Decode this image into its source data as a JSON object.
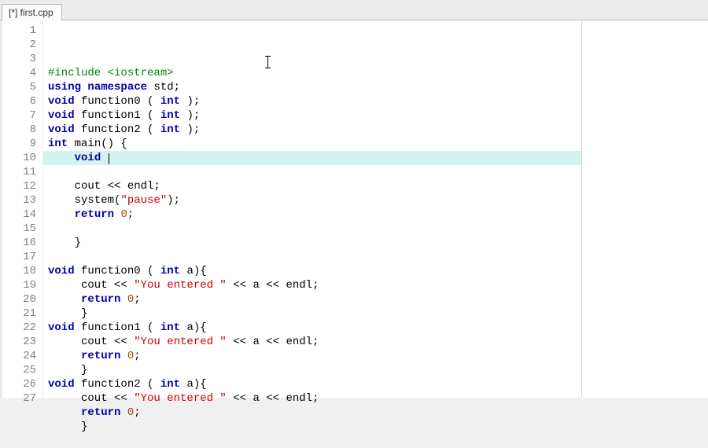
{
  "tab": {
    "title": "[*] first.cpp"
  },
  "lines": [
    {
      "n": 1,
      "segs": [
        [
          "pp",
          "#include "
        ],
        [
          "pp",
          "<iostream>"
        ]
      ]
    },
    {
      "n": 2,
      "segs": [
        [
          "kw",
          "using"
        ],
        [
          "",
          " "
        ],
        [
          "kw",
          "namespace"
        ],
        [
          "",
          " std;"
        ]
      ]
    },
    {
      "n": 3,
      "segs": [
        [
          "kw",
          "void"
        ],
        [
          "",
          " function0 ( "
        ],
        [
          "kw",
          "int"
        ],
        [
          "",
          " );"
        ]
      ]
    },
    {
      "n": 4,
      "segs": [
        [
          "kw",
          "void"
        ],
        [
          "",
          " function1 ( "
        ],
        [
          "kw",
          "int"
        ],
        [
          "",
          " );"
        ]
      ]
    },
    {
      "n": 5,
      "segs": [
        [
          "kw",
          "void"
        ],
        [
          "",
          " function2 ( "
        ],
        [
          "kw",
          "int"
        ],
        [
          "",
          " );"
        ]
      ]
    },
    {
      "n": 6,
      "segs": [
        [
          "kw",
          "int"
        ],
        [
          "",
          " main() {"
        ]
      ]
    },
    {
      "n": 7,
      "hl": true,
      "segs": [
        [
          "",
          "    "
        ],
        [
          "kw",
          "void"
        ],
        [
          "",
          " "
        ]
      ],
      "caret": true
    },
    {
      "n": 8,
      "segs": []
    },
    {
      "n": 9,
      "segs": [
        [
          "",
          "    cout << endl;"
        ]
      ]
    },
    {
      "n": 10,
      "segs": [
        [
          "",
          "    system("
        ],
        [
          "str",
          "\"pause\""
        ],
        [
          "",
          ");"
        ]
      ]
    },
    {
      "n": 11,
      "segs": [
        [
          "",
          "    "
        ],
        [
          "kw",
          "return"
        ],
        [
          "",
          " "
        ],
        [
          "num",
          "0"
        ],
        [
          "",
          ";"
        ]
      ]
    },
    {
      "n": 12,
      "segs": []
    },
    {
      "n": 13,
      "segs": [
        [
          "",
          "    }"
        ]
      ]
    },
    {
      "n": 14,
      "segs": []
    },
    {
      "n": 15,
      "segs": [
        [
          "kw",
          "void"
        ],
        [
          "",
          " function0 ( "
        ],
        [
          "kw",
          "int"
        ],
        [
          "",
          " a){"
        ]
      ]
    },
    {
      "n": 16,
      "segs": [
        [
          "",
          "     cout << "
        ],
        [
          "str",
          "\"You entered \""
        ],
        [
          "",
          " << a << endl;"
        ]
      ]
    },
    {
      "n": 17,
      "segs": [
        [
          "",
          "     "
        ],
        [
          "kw",
          "return"
        ],
        [
          "",
          " "
        ],
        [
          "num",
          "0"
        ],
        [
          "",
          ";"
        ]
      ]
    },
    {
      "n": 18,
      "segs": [
        [
          "",
          "     }"
        ]
      ]
    },
    {
      "n": 19,
      "segs": [
        [
          "kw",
          "void"
        ],
        [
          "",
          " function1 ( "
        ],
        [
          "kw",
          "int"
        ],
        [
          "",
          " a){"
        ]
      ]
    },
    {
      "n": 20,
      "segs": [
        [
          "",
          "     cout << "
        ],
        [
          "str",
          "\"You entered \""
        ],
        [
          "",
          " << a << endl;"
        ]
      ]
    },
    {
      "n": 21,
      "segs": [
        [
          "",
          "     "
        ],
        [
          "kw",
          "return"
        ],
        [
          "",
          " "
        ],
        [
          "num",
          "0"
        ],
        [
          "",
          ";"
        ]
      ]
    },
    {
      "n": 22,
      "segs": [
        [
          "",
          "     }"
        ]
      ]
    },
    {
      "n": 23,
      "segs": [
        [
          "kw",
          "void"
        ],
        [
          "",
          " function2 ( "
        ],
        [
          "kw",
          "int"
        ],
        [
          "",
          " a){"
        ]
      ]
    },
    {
      "n": 24,
      "segs": [
        [
          "",
          "     cout << "
        ],
        [
          "str",
          "\"You entered \""
        ],
        [
          "",
          " << a << endl;"
        ]
      ]
    },
    {
      "n": 25,
      "segs": [
        [
          "",
          "     "
        ],
        [
          "kw",
          "return"
        ],
        [
          "",
          " "
        ],
        [
          "num",
          "0"
        ],
        [
          "",
          ";"
        ]
      ]
    },
    {
      "n": 26,
      "segs": [
        [
          "",
          "     }"
        ]
      ]
    },
    {
      "n": 27,
      "segs": []
    }
  ]
}
